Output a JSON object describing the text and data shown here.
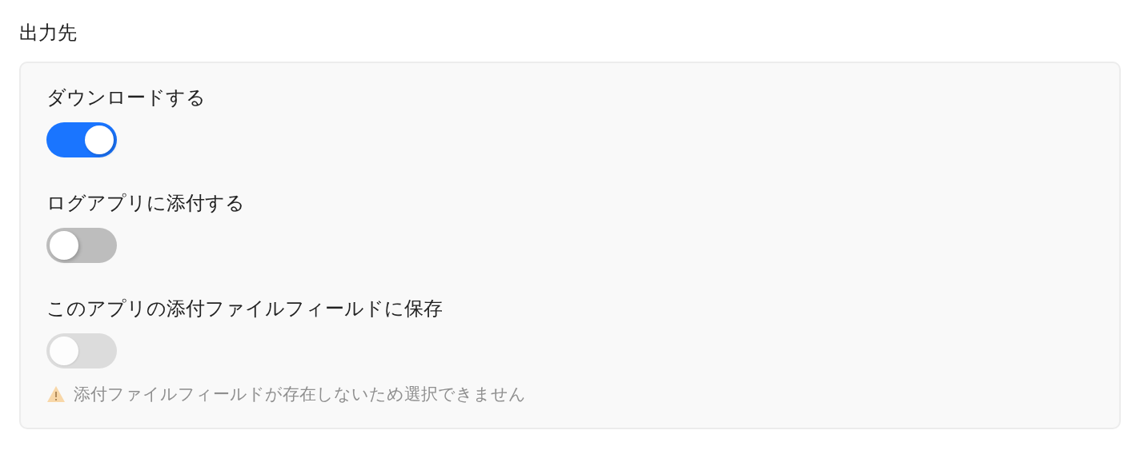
{
  "section_title": "出力先",
  "options": [
    {
      "label": "ダウンロードする",
      "on": true,
      "disabled": false
    },
    {
      "label": "ログアプリに添付する",
      "on": false,
      "disabled": false
    },
    {
      "label": "このアプリの添付ファイルフィールドに保存",
      "on": false,
      "disabled": true,
      "warning": "添付ファイルフィールドが存在しないため選択できません"
    }
  ]
}
